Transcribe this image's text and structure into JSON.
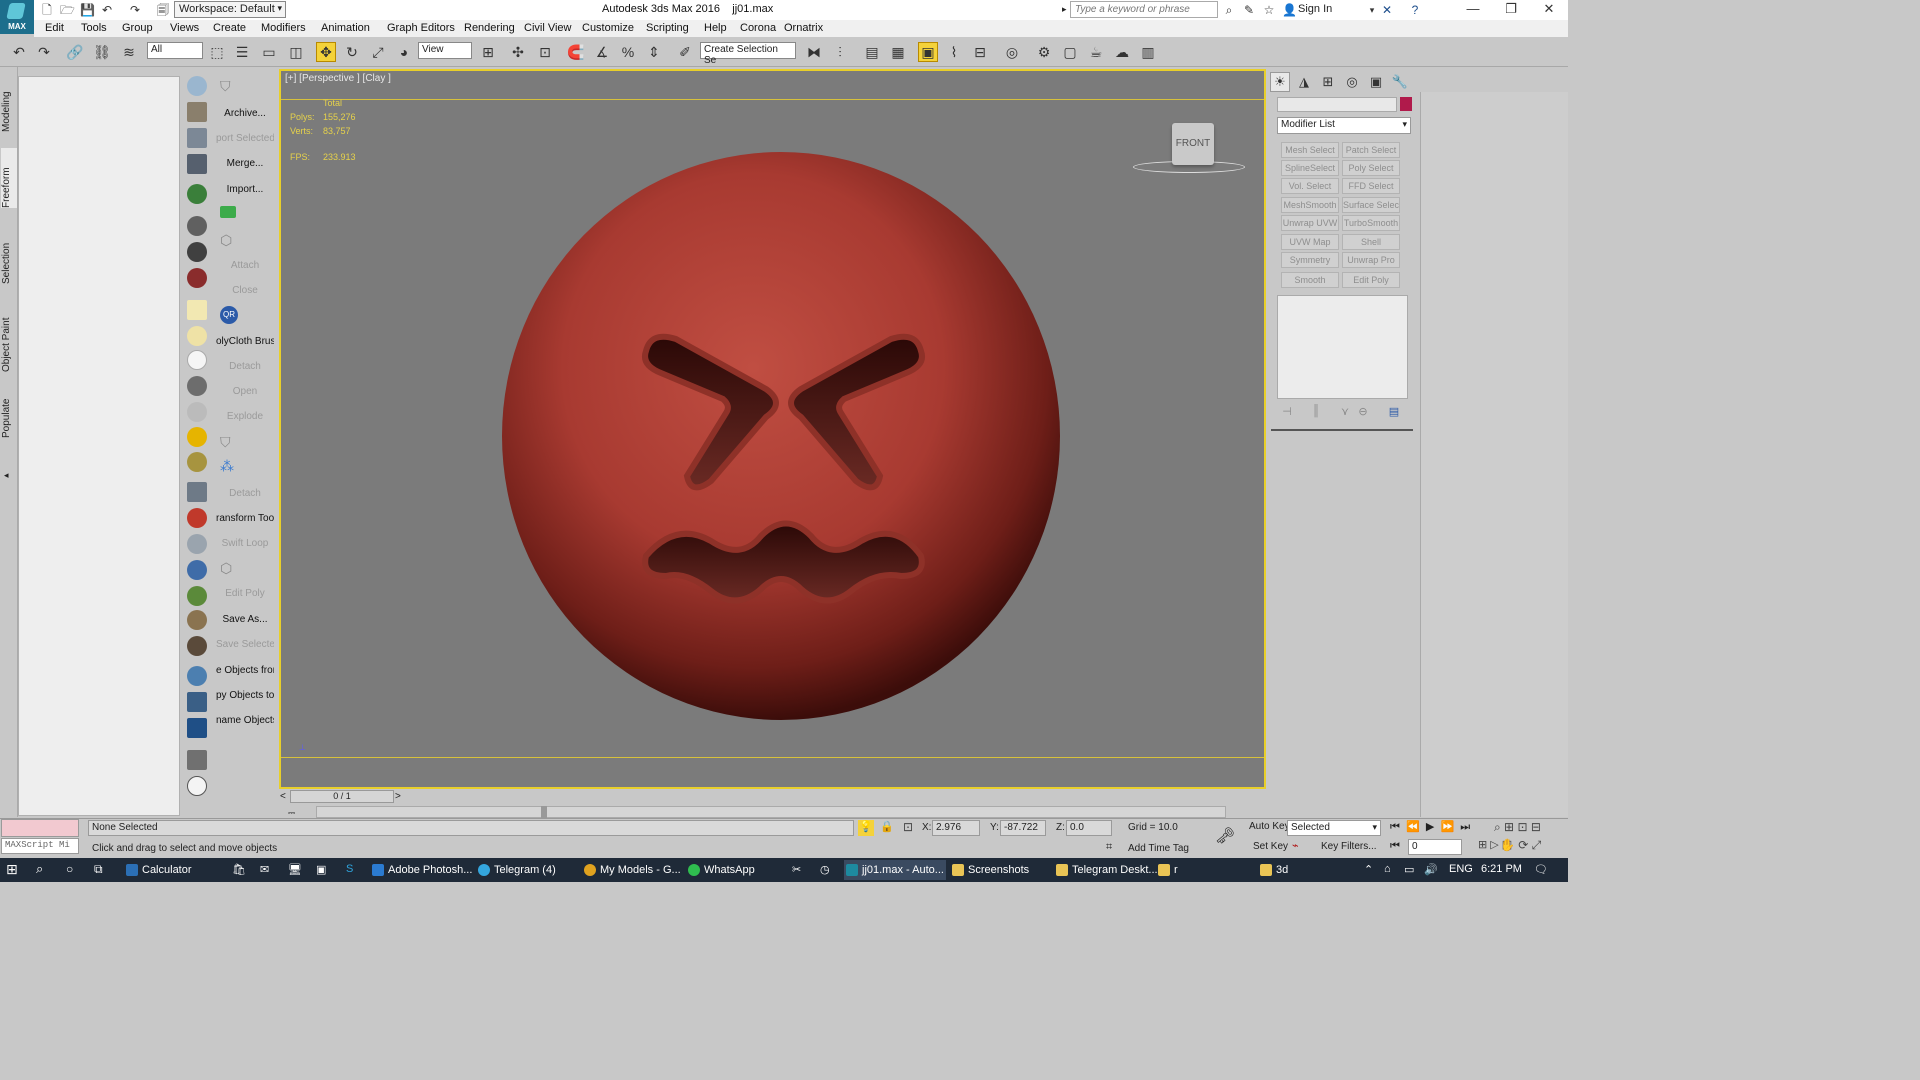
{
  "app": {
    "title": "Autodesk 3ds Max 2016",
    "file": "jj01.max",
    "logo_text": "MAX",
    "workspace": "Workspace: Default",
    "search_placeholder": "Type a keyword or phrase",
    "sign_in": "Sign In"
  },
  "menu": [
    "Edit",
    "Tools",
    "Group",
    "Views",
    "Create",
    "Modifiers",
    "Animation",
    "Graph Editors",
    "Rendering",
    "Civil View",
    "Customize",
    "Scripting",
    "Help",
    "Corona",
    "Ornatrix"
  ],
  "toolbar": {
    "filter_select": "All",
    "ref_coord": "View",
    "selection_set": "Create Selection Se"
  },
  "ribbon_tabs": [
    "Modeling",
    "Freeform",
    "Selection",
    "Object Paint",
    "Populate"
  ],
  "tools": [
    {
      "label": "Archive...",
      "dim": false
    },
    {
      "label": "port Selected",
      "dim": true
    },
    {
      "label": "Merge...",
      "dim": false
    },
    {
      "label": "Import...",
      "dim": false
    },
    {
      "label": "Attach",
      "dim": true
    },
    {
      "label": "Close",
      "dim": true
    },
    {
      "label": "olyCloth Brush",
      "dim": false
    },
    {
      "label": "Detach",
      "dim": true
    },
    {
      "label": "Open",
      "dim": true
    },
    {
      "label": "Explode",
      "dim": true
    },
    {
      "label": "Detach",
      "dim": true
    },
    {
      "label": "ransform Tool",
      "dim": false
    },
    {
      "label": "Swift Loop",
      "dim": true
    },
    {
      "label": "Edit Poly",
      "dim": true
    },
    {
      "label": "Save As...",
      "dim": false
    },
    {
      "label": "Save Selected",
      "dim": true
    },
    {
      "label": "e Objects fron",
      "dim": false
    },
    {
      "label": "py Objects to",
      "dim": false
    },
    {
      "label": "name Objects",
      "dim": false
    }
  ],
  "viewport": {
    "label": "[+] [Perspective ] [Clay ]",
    "stats_header": "Total",
    "polys_label": "Polys:",
    "polys": "155,276",
    "verts_label": "Verts:",
    "verts": "83,757",
    "fps_label": "FPS:",
    "fps": "233.913",
    "viewcube": "FRONT",
    "emoji_color": "#b8443a"
  },
  "command_panel": {
    "modifier_list": "Modifier List",
    "color": "#b01a4b",
    "modifiers": [
      "Mesh Select",
      "Patch Select",
      "SplineSelect",
      "Poly Select",
      "Vol. Select",
      "FFD Select",
      "MeshSmooth",
      "Surface Select",
      "Unwrap UVW",
      "TurboSmooth",
      "UVW Map",
      "Shell",
      "Symmetry",
      "Unwrap Pro",
      "Smooth",
      "Edit Poly"
    ]
  },
  "timeline": {
    "frame": "0 / 1",
    "prev": "<",
    "next": ">"
  },
  "status": {
    "maxscript": "MAXScript Mi",
    "selection": "None Selected",
    "prompt": "Click and drag to select and move objects",
    "x_label": "X:",
    "x": "2.976",
    "y_label": "Y:",
    "y": "-87.722",
    "z_label": "Z:",
    "z": "0.0",
    "grid": "Grid = 10.0",
    "add_time_tag": "Add Time Tag",
    "auto_key": "Auto Key",
    "set_key": "Set Key",
    "key_mode": "Selected",
    "key_filters": "Key Filters...",
    "frame_field": "0"
  },
  "taskbar": {
    "apps": [
      {
        "label": "Calculator",
        "color": "#2b6fb5"
      },
      {
        "label": "Adobe Photosh...",
        "color": "#2b7bd1"
      },
      {
        "label": "Telegram (4)",
        "color": "#34a6de"
      },
      {
        "label": "My Models - G...",
        "color": "#e0a21f"
      },
      {
        "label": "WhatsApp",
        "color": "#2fbd4f"
      },
      {
        "label": "jj01.max - Auto...",
        "color": "#1d8aa0"
      },
      {
        "label": "Screenshots",
        "color": "#e9c455"
      },
      {
        "label": "Telegram Deskt...",
        "color": "#e9c455"
      },
      {
        "label": "r",
        "color": "#e9c455"
      },
      {
        "label": "3d",
        "color": "#e9c455"
      }
    ],
    "lang": "ENG",
    "time": "6:21 PM"
  }
}
